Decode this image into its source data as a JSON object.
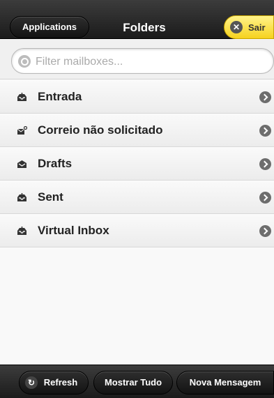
{
  "header": {
    "apps_label": "Applications",
    "title": "Folders",
    "logout_label": "Sair"
  },
  "search": {
    "placeholder": "Filter mailboxes..."
  },
  "folders": [
    {
      "label": "Entrada",
      "icon": "inbox-icon"
    },
    {
      "label": "Correio não solicitado",
      "icon": "junk-mail-icon"
    },
    {
      "label": "Drafts",
      "icon": "drafts-icon"
    },
    {
      "label": "Sent",
      "icon": "sent-icon"
    },
    {
      "label": "Virtual Inbox",
      "icon": "inbox-icon"
    }
  ],
  "footer": {
    "refresh_label": "Refresh",
    "show_all_label": "Mostrar Tudo",
    "new_message_label": "Nova Mensagem"
  },
  "colors": {
    "bar": "#1b1b1b",
    "accent": "#f6d21e"
  }
}
